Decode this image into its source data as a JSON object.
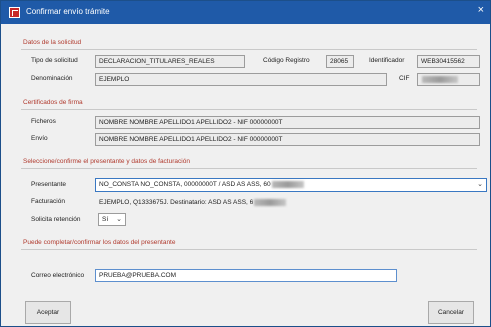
{
  "window": {
    "title": "Confirmar envío trámite",
    "close_glyph": "×"
  },
  "sections": {
    "solicitud": "Datos de la solicitud",
    "certificados": "Certificados de firma",
    "presentante": "Seleccione/confirme el presentante y datos de facturación",
    "completar": "Puede completar/confirmar los datos del presentante"
  },
  "solicitud": {
    "tipo_label": "Tipo de solicitud",
    "tipo_value": "DECLARACION_TITULARES_REALES",
    "codigo_label": "Código Registro",
    "codigo_value": "28065",
    "identificador_label": "Identificador",
    "identificador_value": "WEB30415562",
    "denominacion_label": "Denominación",
    "denominacion_value": "EJEMPLO",
    "cif_label": "CIF"
  },
  "certificados": {
    "ficheros_label": "Ficheros",
    "ficheros_value": "NOMBRE NOMBRE APELLIDO1 APELLIDO2 - NIF 00000000T",
    "envio_label": "Envío",
    "envio_value": "NOMBRE NOMBRE APELLIDO1 APELLIDO2 - NIF 00000000T"
  },
  "presentante": {
    "presentante_label": "Presentante",
    "presentante_value": "NO_CONSTA NO_CONSTA, 00000000T / ASD AS ASS, 60",
    "facturacion_label": "Facturación",
    "facturacion_value": "EJEMPLO, Q1333675J. Destinatario: ASD AS ASS, 6",
    "retencion_label": "Solicita retención",
    "retencion_value": "Sí"
  },
  "contacto": {
    "correo_label": "Correo electrónico",
    "correo_value": "PRUEBA@PRUEBA.COM"
  },
  "buttons": {
    "aceptar": "Aceptar",
    "cancelar": "Cancelar"
  }
}
